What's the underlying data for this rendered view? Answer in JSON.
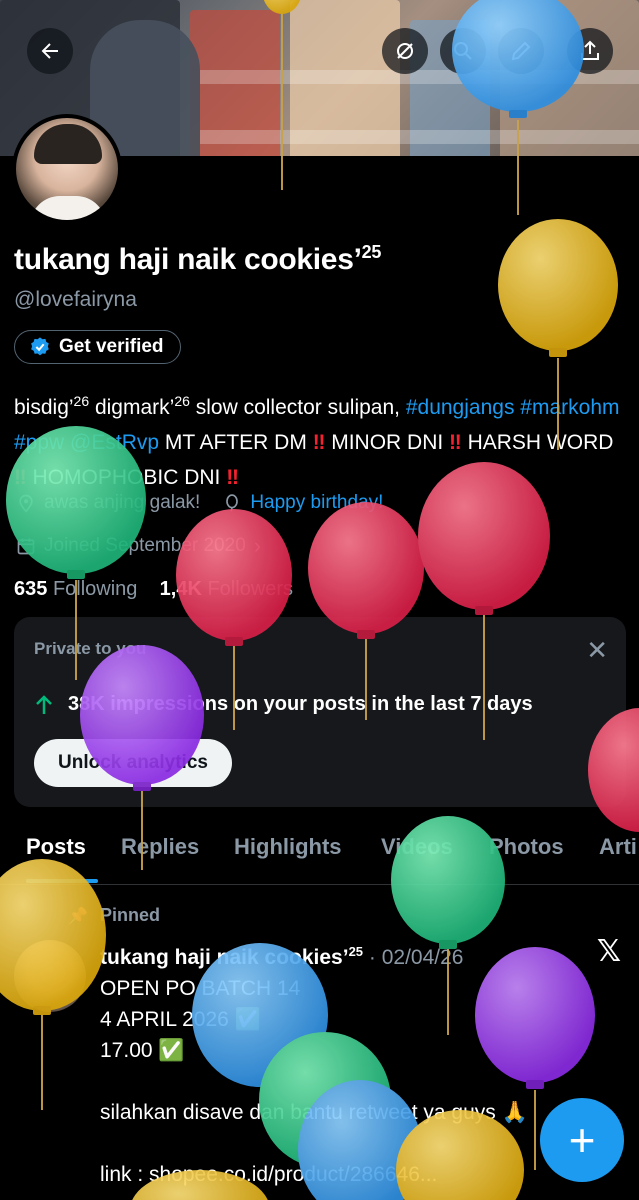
{
  "profile": {
    "display_name": "tukang haji naik cookies’",
    "display_name_sup": "25",
    "handle": "@lovefairyna",
    "verified_label": "Get verified",
    "bio": {
      "t1": "bisdig’",
      "t1sup": "26",
      "t2": " digmark’",
      "t2sup": "26",
      "t3": " slow collector sulipan, ",
      "tag1": "#dungjangs",
      "tag2": "#markohm",
      "sp1": " ",
      "tag3": "#ppw",
      "sp2": " ",
      "mention": "@EstRvp",
      "t4": " MT AFTER DM ",
      "t5": " MINOR DNI ",
      "t6": " HARSH WORD ",
      "t7": " HOMOPHOBIC DNI ",
      "bang": "‼"
    },
    "location": "awas anjing galak!",
    "birthday": "Happy birthday!",
    "joined": "Joined September 2020",
    "following_count": "635",
    "following_label": "Following",
    "followers_count": "1,4K",
    "followers_label": "Followers"
  },
  "analytics": {
    "private_label": "Private to you",
    "impressions_count": "38K",
    "impressions_text": " impressions on your posts in the last 7 days",
    "unlock_label": "Unlock analytics"
  },
  "tabs": [
    "Posts",
    "Replies",
    "Highlights",
    "Videos",
    "Photos",
    "Arti"
  ],
  "pinned_post": {
    "pinned_label": "Pinned",
    "author": "tukang haji naik cookies’",
    "author_sup": "25",
    "date": " · 02/04/26",
    "lines": [
      "OPEN PO BATCH 14",
      "4 APRIL 2026 ✅",
      "17.00 ✅",
      "",
      "silahkan disave dan bantu retweet ya guys 🙏",
      "",
      "link : shopee.co.id/product/286646..."
    ]
  },
  "colors": {
    "accent": "#1d9bf0",
    "background": "#000000",
    "muted": "#8b98a5",
    "alert": "#f4212e"
  },
  "icons": {
    "back": "arrow-left-icon",
    "verified": "verified-badge-icon",
    "location": "location-pin-icon",
    "birthday": "balloon-icon",
    "calendar": "calendar-icon",
    "close": "close-icon",
    "impressions": "arrow-up-icon",
    "pin": "pin-icon",
    "x": "x-logo-icon",
    "compose": "plus-icon"
  }
}
